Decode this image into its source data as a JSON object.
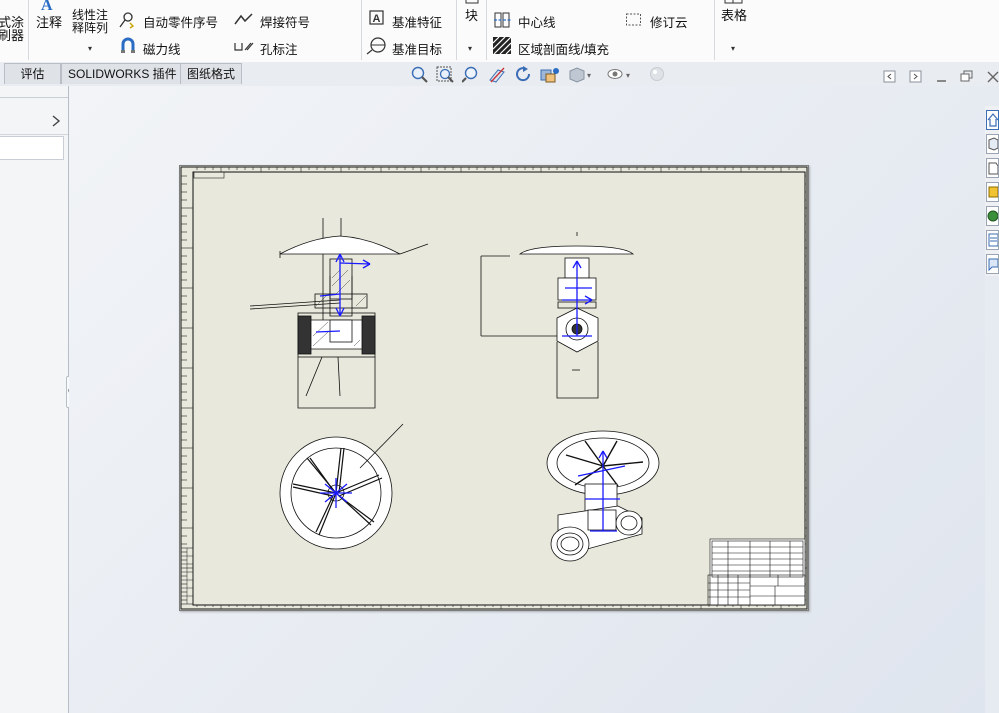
{
  "ribbon": {
    "left_cut_label_1": "式涂",
    "left_cut_label_2": "刷器",
    "annotation_label": "注释",
    "linear_note_pattern_label_1": "线性注",
    "linear_note_pattern_label_2": "释阵列",
    "auto_balloon_label": "自动零件序号",
    "magnetic_line_label": "磁力线",
    "weld_symbol_label": "焊接符号",
    "hole_callout_label": "孔标注",
    "datum_feature_label": "基准特征",
    "datum_target_label": "基准目标",
    "block_label": "块",
    "centerline_label": "中心线",
    "area_hatch_label": "区域剖面线/填充",
    "revision_cloud_label": "修订云",
    "table_label": "表格"
  },
  "tabs": [
    "评估",
    "SOLIDWORKS 插件",
    "图纸格式"
  ],
  "colors": {
    "sheet_background": "#e8e8dc",
    "ribbon_background": "#fbfbfb",
    "accent_icon_blue": "#2b6cc4",
    "arrow_blue": "#1a1aff"
  },
  "view_toolbar_icons": [
    "zoom-to-fit-icon",
    "zoom-to-area-icon",
    "previous-view-icon",
    "section-view-icon",
    "dynamic-annotation-icon",
    "view-orientation-icon",
    "display-style-icon",
    "hide-show-items-icon",
    "appearance-icon"
  ],
  "task_pane_icons": [
    "home-icon",
    "3d-part-icon",
    "file-explorer-icon",
    "design-library-icon",
    "view-palette-icon",
    "appearances-icon",
    "custom-properties-icon"
  ]
}
